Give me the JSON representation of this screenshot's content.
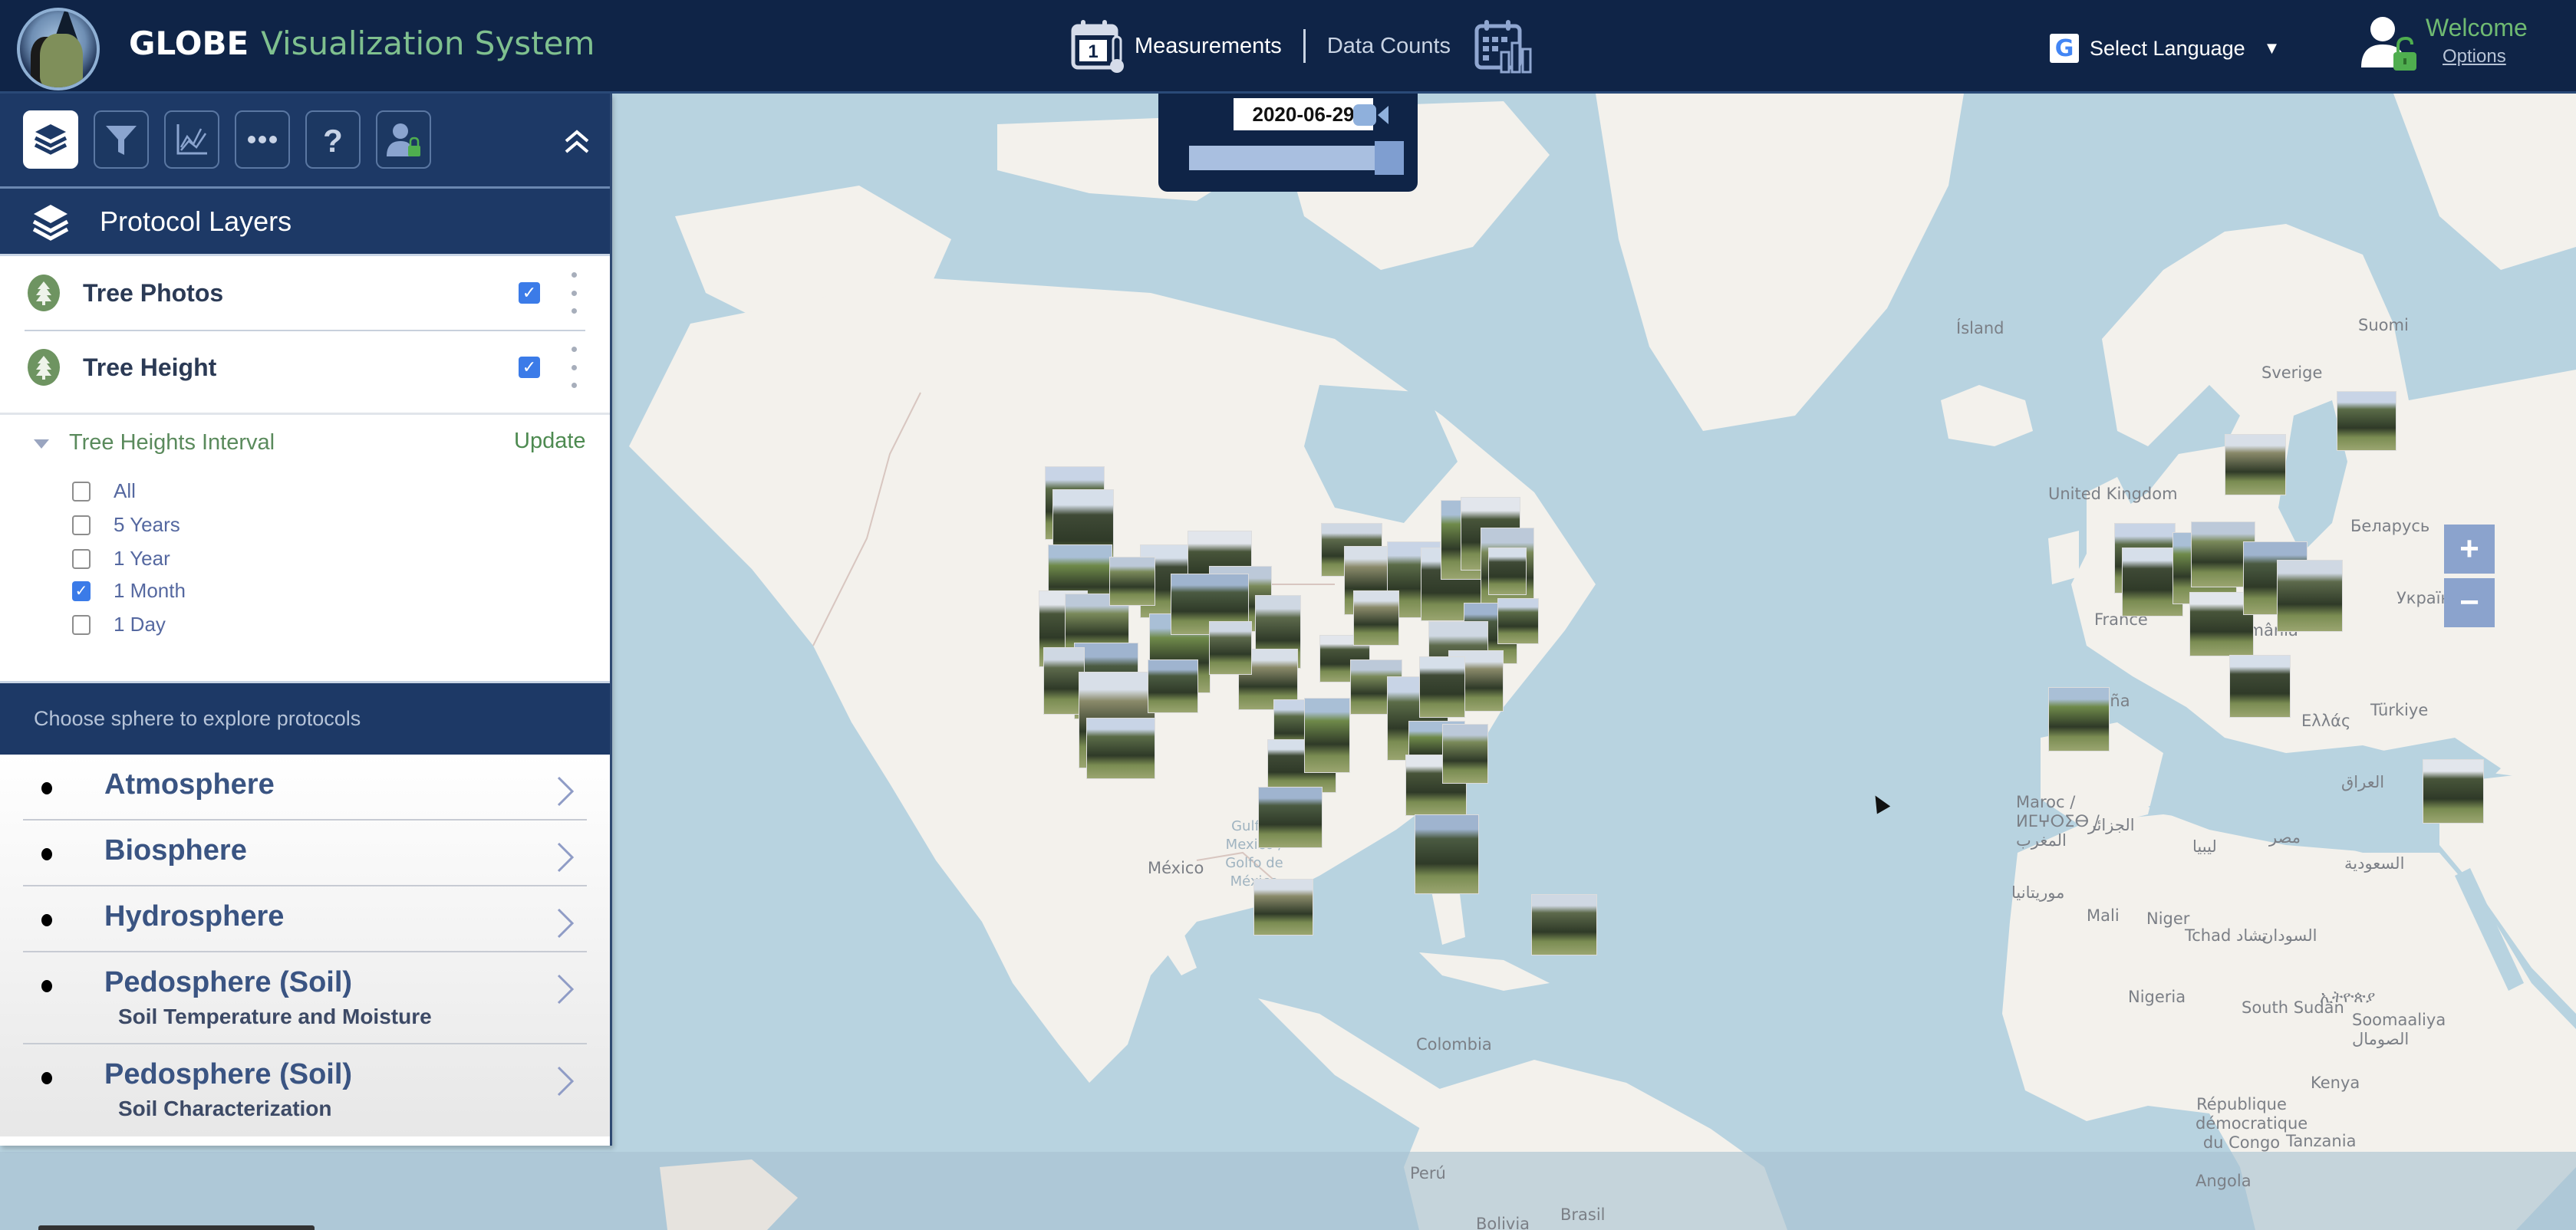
{
  "header": {
    "brand_bold": "GLOBE",
    "brand_rest": "Visualization System",
    "nav_measurements": "Measurements",
    "nav_data_counts": "Data Counts",
    "calendar_day": "1",
    "language_label": "Select Language",
    "language_caret": "▼",
    "google_letter": "G",
    "welcome": "Welcome",
    "options": "Options"
  },
  "date_control": {
    "date": "2020-06-29",
    "slider_fraction": 1.0
  },
  "sidebar": {
    "section_title": "Protocol Layers",
    "collapse_icon": "double-chevron-up-icon",
    "toolbar": [
      {
        "name": "layers",
        "icon": "layers-icon",
        "active": true
      },
      {
        "name": "filter",
        "icon": "filter-icon",
        "active": false
      },
      {
        "name": "chart",
        "icon": "line-chart-icon",
        "active": false
      },
      {
        "name": "more",
        "icon": "ellipsis-icon",
        "active": false
      },
      {
        "name": "help",
        "icon": "help-icon",
        "active": false
      },
      {
        "name": "account",
        "icon": "user-lock-icon",
        "active": false
      }
    ],
    "layers": [
      {
        "name": "Tree Photos",
        "checked": true
      },
      {
        "name": "Tree Height",
        "checked": true
      }
    ],
    "interval": {
      "title": "Tree Heights Interval",
      "update_label": "Update",
      "options": [
        {
          "label": "All",
          "checked": false
        },
        {
          "label": "5 Years",
          "checked": false
        },
        {
          "label": "1 Year",
          "checked": false
        },
        {
          "label": "1 Month",
          "checked": true
        },
        {
          "label": "1 Day",
          "checked": false
        }
      ]
    },
    "sphere_prompt": "Choose sphere to explore protocols",
    "spheres": [
      {
        "label": "Atmosphere",
        "sub": ""
      },
      {
        "label": "Biosphere",
        "sub": ""
      },
      {
        "label": "Hydrosphere",
        "sub": ""
      },
      {
        "label": "Pedosphere (Soil)",
        "sub": "Soil Temperature and Moisture"
      },
      {
        "label": "Pedosphere (Soil)",
        "sub": "Soil Characterization"
      }
    ]
  },
  "map": {
    "zoom_in": "+",
    "zoom_out": "−",
    "labels": [
      {
        "text": "Ísland"
      },
      {
        "text": "Sverige"
      },
      {
        "text": "Suomi"
      },
      {
        "text": "United Kingdom"
      },
      {
        "text": "Беларусь"
      },
      {
        "text": "Україна"
      },
      {
        "text": "France"
      },
      {
        "text": "România"
      },
      {
        "text": "España"
      },
      {
        "text": "Ελλάς"
      },
      {
        "text": "Türkiye"
      },
      {
        "text": "Maroc / ⵍⵎⵖⵔⵉⴱ / المغرب"
      },
      {
        "text": "الجزائر"
      },
      {
        "text": "ليبيا"
      },
      {
        "text": "مصر"
      },
      {
        "text": "العراق"
      },
      {
        "text": "السعودية"
      },
      {
        "text": "موريتانيا"
      },
      {
        "text": "Mali"
      },
      {
        "text": "Niger"
      },
      {
        "text": "Tchad تشاد"
      },
      {
        "text": "السودان"
      },
      {
        "text": "Nigeria"
      },
      {
        "text": "South Sudan"
      },
      {
        "text": "ኢትዮጵያ"
      },
      {
        "text": "Soomaaliya الصومال"
      },
      {
        "text": "Kenya"
      },
      {
        "text": "République démocratique du Congo"
      },
      {
        "text": "Tanzania"
      },
      {
        "text": "Angola"
      },
      {
        "text": "México"
      },
      {
        "text": "Gulf of Mexico / Golfo de México"
      },
      {
        "text": "Colombia"
      },
      {
        "text": "Perú"
      },
      {
        "text": "Brasil"
      },
      {
        "text": "Bolivia"
      }
    ],
    "photo_markers_visible": 58
  }
}
